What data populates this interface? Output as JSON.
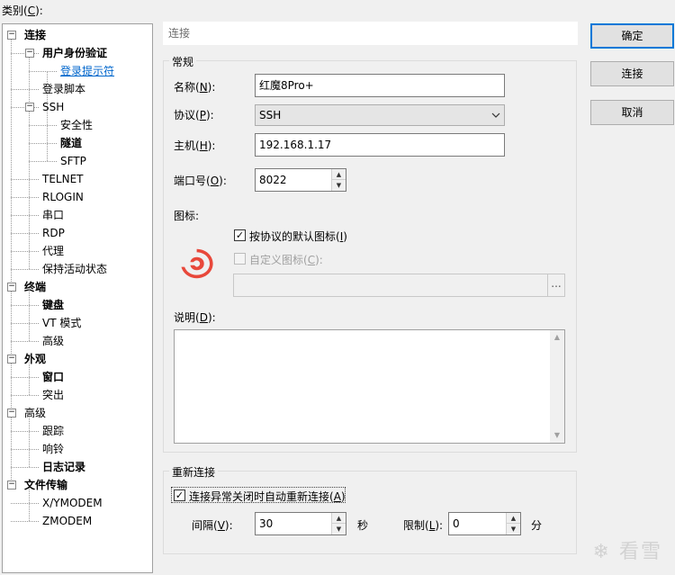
{
  "category_label": "类别(C):",
  "category_label_parts": {
    "pre": "类别(",
    "key": "C",
    "post": "):"
  },
  "tree": [
    {
      "label": "连接",
      "bold": true
    },
    {
      "label": "用户身份验证",
      "bold": true
    },
    {
      "label": "登录提示符",
      "selected": true
    },
    {
      "label": "登录脚本"
    },
    {
      "label": "SSH"
    },
    {
      "label": "安全性"
    },
    {
      "label": "隧道",
      "bold": true
    },
    {
      "label": "SFTP"
    },
    {
      "label": "TELNET"
    },
    {
      "label": "RLOGIN"
    },
    {
      "label": "串口"
    },
    {
      "label": "RDP"
    },
    {
      "label": "代理"
    },
    {
      "label": "保持活动状态"
    },
    {
      "label": "终端",
      "bold": true
    },
    {
      "label": "键盘",
      "bold": true
    },
    {
      "label": "VT 模式"
    },
    {
      "label": "高级"
    },
    {
      "label": "外观",
      "bold": true
    },
    {
      "label": "窗口",
      "bold": true
    },
    {
      "label": "突出"
    },
    {
      "label": "高级"
    },
    {
      "label": "跟踪"
    },
    {
      "label": "响铃"
    },
    {
      "label": "日志记录",
      "bold": true
    },
    {
      "label": "文件传输",
      "bold": true
    },
    {
      "label": "X/YMODEM"
    },
    {
      "label": "ZMODEM"
    }
  ],
  "panel_title": "连接",
  "general": {
    "title": "常规",
    "name": {
      "pre": "名称(",
      "key": "N",
      "post": "):",
      "value": "红魔8Pro+"
    },
    "protocol": {
      "pre": "协议(",
      "key": "P",
      "post": "):",
      "value": "SSH"
    },
    "host": {
      "pre": "主机(",
      "key": "H",
      "post": "):",
      "value": "192.168.1.17"
    },
    "port": {
      "pre": "端口号(",
      "key": "O",
      "post": "):",
      "value": "8022"
    },
    "icon_label": "图标:",
    "default_icon": {
      "pre": "按协议的默认图标(",
      "key": "I",
      "post": ")",
      "checked": true
    },
    "custom_icon": {
      "pre": "自定义图标(",
      "key": "C",
      "post": "):",
      "checked": false
    },
    "browse_label": "...",
    "description": {
      "pre": "说明(",
      "key": "D",
      "post": "):",
      "value": ""
    }
  },
  "reconnect": {
    "title": "重新连接",
    "auto": {
      "pre": "连接异常关闭时自动重新连接(",
      "key": "A",
      "post": ")",
      "checked": true
    },
    "interval": {
      "pre": "间隔(",
      "key": "V",
      "post": "):",
      "value": "30",
      "unit": "秒"
    },
    "limit": {
      "pre": "限制(",
      "key": "L",
      "post": "):",
      "value": "0",
      "unit": "分"
    }
  },
  "buttons": {
    "ok": "确定",
    "connect": "连接",
    "cancel": "取消"
  },
  "watermark": "看雪",
  "colors": {
    "accent": "#0078d7",
    "icon_red": "#e8483b",
    "selected_link": "#0066cc"
  }
}
